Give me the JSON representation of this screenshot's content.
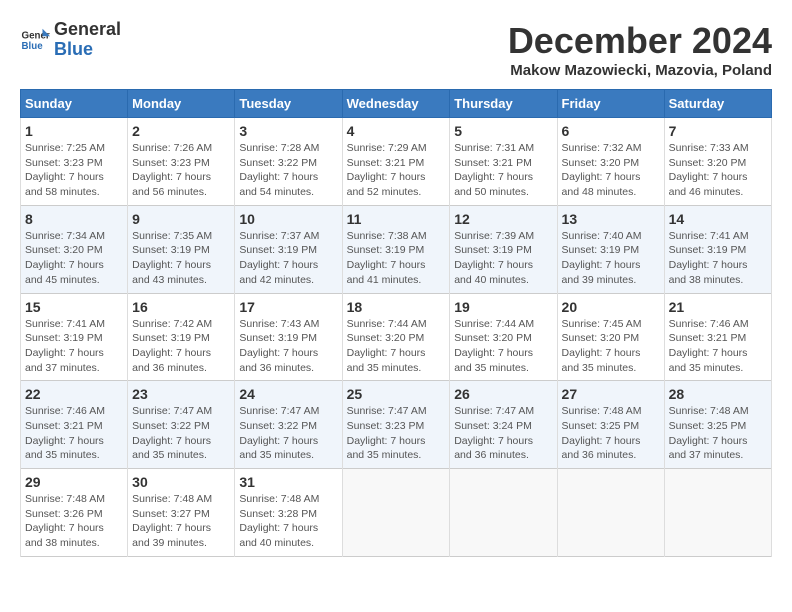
{
  "logo": {
    "general": "General",
    "blue": "Blue"
  },
  "title": "December 2024",
  "location": "Makow Mazowiecki, Mazovia, Poland",
  "headers": [
    "Sunday",
    "Monday",
    "Tuesday",
    "Wednesday",
    "Thursday",
    "Friday",
    "Saturday"
  ],
  "weeks": [
    [
      {
        "day": "1",
        "sunrise": "7:25 AM",
        "sunset": "3:23 PM",
        "daylight": "7 hours and 58 minutes."
      },
      {
        "day": "2",
        "sunrise": "7:26 AM",
        "sunset": "3:23 PM",
        "daylight": "7 hours and 56 minutes."
      },
      {
        "day": "3",
        "sunrise": "7:28 AM",
        "sunset": "3:22 PM",
        "daylight": "7 hours and 54 minutes."
      },
      {
        "day": "4",
        "sunrise": "7:29 AM",
        "sunset": "3:21 PM",
        "daylight": "7 hours and 52 minutes."
      },
      {
        "day": "5",
        "sunrise": "7:31 AM",
        "sunset": "3:21 PM",
        "daylight": "7 hours and 50 minutes."
      },
      {
        "day": "6",
        "sunrise": "7:32 AM",
        "sunset": "3:20 PM",
        "daylight": "7 hours and 48 minutes."
      },
      {
        "day": "7",
        "sunrise": "7:33 AM",
        "sunset": "3:20 PM",
        "daylight": "7 hours and 46 minutes."
      }
    ],
    [
      {
        "day": "8",
        "sunrise": "7:34 AM",
        "sunset": "3:20 PM",
        "daylight": "7 hours and 45 minutes."
      },
      {
        "day": "9",
        "sunrise": "7:35 AM",
        "sunset": "3:19 PM",
        "daylight": "7 hours and 43 minutes."
      },
      {
        "day": "10",
        "sunrise": "7:37 AM",
        "sunset": "3:19 PM",
        "daylight": "7 hours and 42 minutes."
      },
      {
        "day": "11",
        "sunrise": "7:38 AM",
        "sunset": "3:19 PM",
        "daylight": "7 hours and 41 minutes."
      },
      {
        "day": "12",
        "sunrise": "7:39 AM",
        "sunset": "3:19 PM",
        "daylight": "7 hours and 40 minutes."
      },
      {
        "day": "13",
        "sunrise": "7:40 AM",
        "sunset": "3:19 PM",
        "daylight": "7 hours and 39 minutes."
      },
      {
        "day": "14",
        "sunrise": "7:41 AM",
        "sunset": "3:19 PM",
        "daylight": "7 hours and 38 minutes."
      }
    ],
    [
      {
        "day": "15",
        "sunrise": "7:41 AM",
        "sunset": "3:19 PM",
        "daylight": "7 hours and 37 minutes."
      },
      {
        "day": "16",
        "sunrise": "7:42 AM",
        "sunset": "3:19 PM",
        "daylight": "7 hours and 36 minutes."
      },
      {
        "day": "17",
        "sunrise": "7:43 AM",
        "sunset": "3:19 PM",
        "daylight": "7 hours and 36 minutes."
      },
      {
        "day": "18",
        "sunrise": "7:44 AM",
        "sunset": "3:20 PM",
        "daylight": "7 hours and 35 minutes."
      },
      {
        "day": "19",
        "sunrise": "7:44 AM",
        "sunset": "3:20 PM",
        "daylight": "7 hours and 35 minutes."
      },
      {
        "day": "20",
        "sunrise": "7:45 AM",
        "sunset": "3:20 PM",
        "daylight": "7 hours and 35 minutes."
      },
      {
        "day": "21",
        "sunrise": "7:46 AM",
        "sunset": "3:21 PM",
        "daylight": "7 hours and 35 minutes."
      }
    ],
    [
      {
        "day": "22",
        "sunrise": "7:46 AM",
        "sunset": "3:21 PM",
        "daylight": "7 hours and 35 minutes."
      },
      {
        "day": "23",
        "sunrise": "7:47 AM",
        "sunset": "3:22 PM",
        "daylight": "7 hours and 35 minutes."
      },
      {
        "day": "24",
        "sunrise": "7:47 AM",
        "sunset": "3:22 PM",
        "daylight": "7 hours and 35 minutes."
      },
      {
        "day": "25",
        "sunrise": "7:47 AM",
        "sunset": "3:23 PM",
        "daylight": "7 hours and 35 minutes."
      },
      {
        "day": "26",
        "sunrise": "7:47 AM",
        "sunset": "3:24 PM",
        "daylight": "7 hours and 36 minutes."
      },
      {
        "day": "27",
        "sunrise": "7:48 AM",
        "sunset": "3:25 PM",
        "daylight": "7 hours and 36 minutes."
      },
      {
        "day": "28",
        "sunrise": "7:48 AM",
        "sunset": "3:25 PM",
        "daylight": "7 hours and 37 minutes."
      }
    ],
    [
      {
        "day": "29",
        "sunrise": "7:48 AM",
        "sunset": "3:26 PM",
        "daylight": "7 hours and 38 minutes."
      },
      {
        "day": "30",
        "sunrise": "7:48 AM",
        "sunset": "3:27 PM",
        "daylight": "7 hours and 39 minutes."
      },
      {
        "day": "31",
        "sunrise": "7:48 AM",
        "sunset": "3:28 PM",
        "daylight": "7 hours and 40 minutes."
      },
      null,
      null,
      null,
      null
    ]
  ]
}
